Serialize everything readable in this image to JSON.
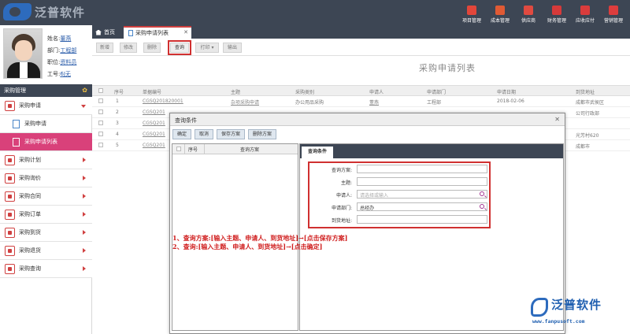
{
  "app": {
    "logo_text": "泛普软件"
  },
  "modules": [
    {
      "label": "项目管理",
      "icon": "project-icon",
      "color": "#e2463a"
    },
    {
      "label": "成本管理",
      "icon": "cost-icon",
      "color": "#e05a34"
    },
    {
      "label": "供应商",
      "icon": "supplier-icon",
      "color": "#e04a40"
    },
    {
      "label": "财务管理",
      "icon": "finance-icon",
      "color": "#d63a3a"
    },
    {
      "label": "应收应付",
      "icon": "receivable-icon",
      "color": "#d93c3c"
    },
    {
      "label": "营销管理",
      "icon": "marketing-icon",
      "color": "#dd3d3d"
    }
  ],
  "profile": {
    "name_label": "姓名:",
    "name": "董燕",
    "dept_label": "部门:",
    "dept": "工程部",
    "position_label": "职位:",
    "position": "资料员",
    "empno_label": "工号:",
    "empno": "6J无"
  },
  "sidebar": {
    "header": "采购管理",
    "items": [
      {
        "label": "采购申请",
        "open": true
      },
      {
        "label": "采购计划"
      },
      {
        "label": "采购询价"
      },
      {
        "label": "采购合同"
      },
      {
        "label": "采购订单"
      },
      {
        "label": "采购到货"
      },
      {
        "label": "采购退货"
      },
      {
        "label": "采购查询"
      }
    ],
    "subitems": [
      {
        "label": "采购申请"
      },
      {
        "label": "采购申请列表"
      }
    ]
  },
  "tabs": {
    "home": "首页",
    "active": "采购申请列表"
  },
  "toolbar": {
    "add": "新增",
    "edit": "修改",
    "delete": "删除",
    "query": "查询",
    "print": "打印",
    "export": "输出"
  },
  "page": {
    "title": "采购申请列表"
  },
  "grid": {
    "headers": [
      "序号",
      "单据编号",
      "主题",
      "采购类别",
      "申请人",
      "申请部门",
      "申请日期",
      "到货地址"
    ],
    "rows": [
      {
        "no": "1",
        "code": "CGSQ201820001",
        "subject": "杂项采购申请",
        "category": "办公用品采购",
        "applicant": "董燕",
        "dept": "工程部",
        "date": "2018-02-06",
        "address": "成都市武侯区"
      },
      {
        "no": "2",
        "code": "CGSQ201",
        "subject": "",
        "category": "",
        "applicant": "",
        "dept": "",
        "date": "",
        "address": "公司行政部"
      },
      {
        "no": "3",
        "code": "CGSQ201",
        "subject": "",
        "category": "",
        "applicant": "",
        "dept": "",
        "date": "",
        "address": ""
      },
      {
        "no": "4",
        "code": "CGSQ201",
        "subject": "",
        "category": "",
        "applicant": "",
        "dept": "",
        "date": "",
        "address": "光芳村620"
      },
      {
        "no": "5",
        "code": "CGSQ201",
        "subject": "",
        "category": "",
        "applicant": "",
        "dept": "",
        "date": "",
        "address": "成都市"
      }
    ]
  },
  "modal": {
    "title": "查询条件",
    "buttons": {
      "confirm": "确定",
      "cancel": "取消",
      "save": "保存方案",
      "remove": "删除方案"
    },
    "left_headers": {
      "no": "序号",
      "scheme": "查询方案"
    },
    "right_tab": "查询条件",
    "fields": [
      {
        "label": "查询方案:",
        "value": "",
        "placeholder": ""
      },
      {
        "label": "主题:",
        "value": "",
        "placeholder": ""
      },
      {
        "label": "申请人:",
        "value": "",
        "placeholder": "请选择或输入",
        "search": true
      },
      {
        "label": "申请部门:",
        "value": "总经办",
        "placeholder": "",
        "search": true
      },
      {
        "label": "到货地址:",
        "value": "",
        "placeholder": ""
      }
    ]
  },
  "annotation": {
    "line1": "1、查询方案:[输入主题、申请人、到货地址]→[点击保存方案]",
    "line2": "2、查询:[输入主题、申请人、到货地址]→[点击确定]"
  },
  "watermark": {
    "brand": "泛普软件",
    "url": "www.fanpusoft.com"
  }
}
